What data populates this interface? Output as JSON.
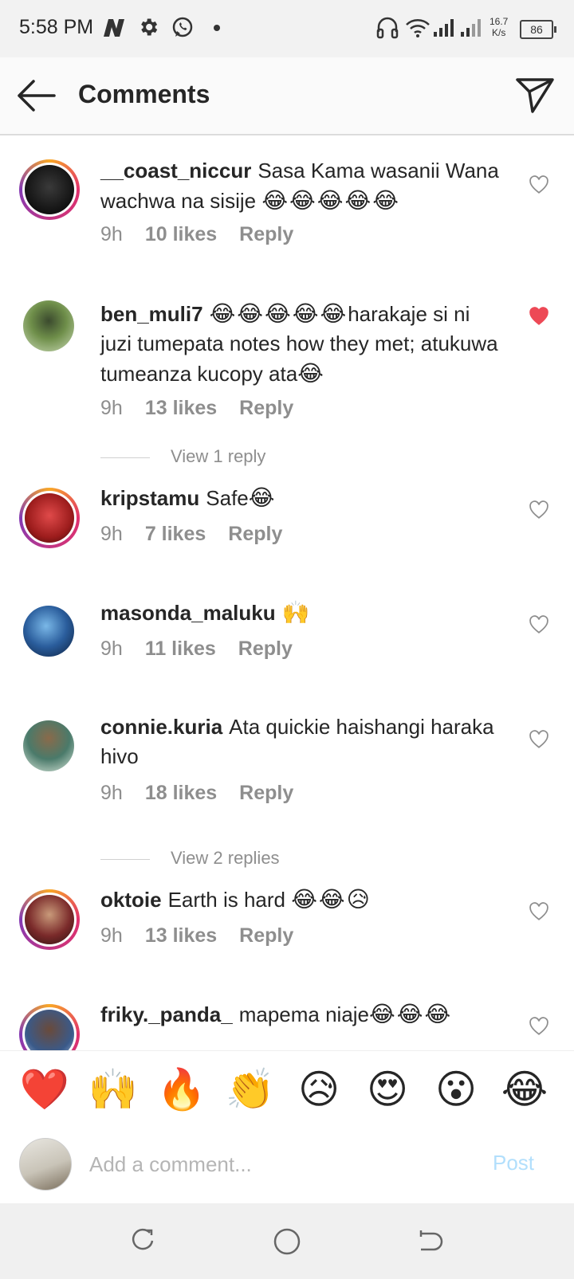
{
  "status_bar": {
    "time": "5:58 PM",
    "speed_value": "16.7",
    "speed_unit": "K/s",
    "battery": "86",
    "icons": [
      "n-icon",
      "gear-icon",
      "whatsapp-icon",
      "dot-icon",
      "headphones-icon",
      "wifi-icon",
      "signal-icon",
      "signal-icon",
      "battery-icon"
    ]
  },
  "header": {
    "title": "Comments"
  },
  "comments": [
    {
      "user": "__coast_niccur",
      "text": "Sasa Kama wasanii Wana wachwa na sisije",
      "emoji": "😂😂😂😂😂",
      "time": "9h",
      "likes": "10 likes",
      "reply": "Reply",
      "liked": false
    },
    {
      "user": "ben_muli7",
      "emoji": "😂😂😂😂😂",
      "text": "harakaje si ni juzi tumepata notes how they met; atukuwa tumeanza kucopy ata",
      "emoji_end": "😂",
      "time": "9h",
      "likes": "13 likes",
      "reply": "Reply",
      "liked": true
    },
    {
      "user": "kripstamu",
      "text": "Safe",
      "emoji": "😂",
      "time": "9h",
      "likes": "7 likes",
      "reply": "Reply",
      "liked": false
    },
    {
      "user": "masonda_maluku",
      "text": "",
      "emoji": "🙌",
      "time": "9h",
      "likes": "11 likes",
      "reply": "Reply",
      "liked": false
    },
    {
      "user": "connie.kuria",
      "text": "Ata quickie haishangi haraka hivo",
      "emoji": "",
      "time": "9h",
      "likes": "18 likes",
      "reply": "Reply",
      "liked": false
    },
    {
      "user": "oktoie",
      "text": "Earth is hard",
      "emoji": "😂😂😥",
      "time": "9h",
      "likes": "13 likes",
      "reply": "Reply",
      "liked": false
    },
    {
      "user": "friky._panda_",
      "text": "mapema niaje",
      "emoji": "😂😂😂",
      "liked": false
    }
  ],
  "view_replies": [
    "View 1 reply",
    "View 2 replies"
  ],
  "emoji_bar": [
    "❤️",
    "🙌",
    "🔥",
    "👏",
    "😥",
    "😍",
    "😮",
    "😂"
  ],
  "compose": {
    "placeholder": "Add a comment...",
    "post_label": "Post"
  },
  "nav": {
    "icons": [
      "recent-apps-icon",
      "home-icon",
      "back-icon"
    ]
  }
}
